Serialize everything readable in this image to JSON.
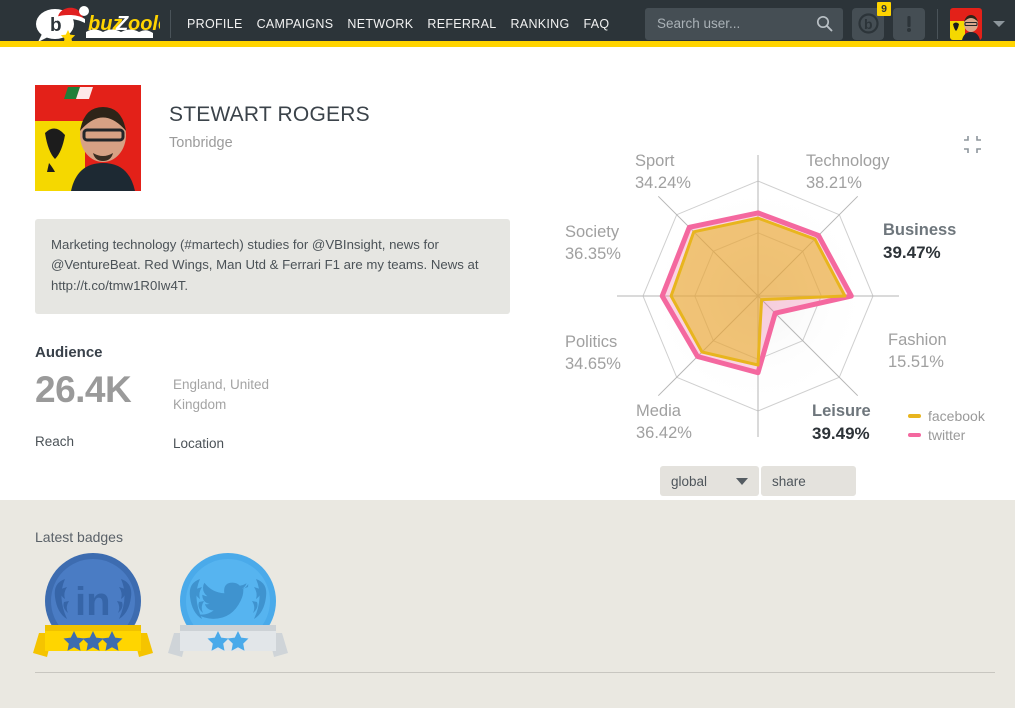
{
  "brand": {
    "logo_text": "buzZoole",
    "accent_yellow": "#ffd400",
    "header_bg": "#2c3439"
  },
  "header": {
    "nav": [
      {
        "label": "PROFILE",
        "name": "nav-profile"
      },
      {
        "label": "CAMPAIGNS",
        "name": "nav-campaigns"
      },
      {
        "label": "NETWORK",
        "name": "nav-network"
      },
      {
        "label": "REFERRAL",
        "name": "nav-referral"
      },
      {
        "label": "RANKING",
        "name": "nav-ranking"
      },
      {
        "label": "FAQ",
        "name": "nav-faq"
      }
    ],
    "search": {
      "placeholder": "Search user...",
      "value": "",
      "icon": "search-icon"
    },
    "buzz_button": {
      "icon": "buzzoole-b-icon",
      "badge_count": "9"
    },
    "alert_button": {
      "icon": "exclamation-icon"
    },
    "account": {
      "icon": "avatar",
      "caret": "chevron-down-icon"
    }
  },
  "profile": {
    "name": "STEWART ROGERS",
    "city": "Tonbridge",
    "bio": "Marketing technology (#martech) studies for @VBInsight, news for @VentureBeat. Red Wings, Man Utd & Ferrari F1 are my teams. News at http://t.co/tmw1R0Iw4T.",
    "audience_heading": "Audience",
    "reach_value": "26.4K",
    "reach_label": "Reach",
    "location_value": "England, United Kingdom",
    "location_label": "Location"
  },
  "radar": {
    "collapse_icon": "collapse-icon",
    "controls": {
      "scope_selected": "global",
      "scope_caret": "chevron-down-icon",
      "share_label": "share"
    },
    "legend": [
      {
        "label": "facebook",
        "color": "#e8b51e"
      },
      {
        "label": "twitter",
        "color": "#f4689f"
      }
    ]
  },
  "chart_data": {
    "type": "radar",
    "title": "",
    "categories": [
      "Technology",
      "Business",
      "Fashion",
      "Leisure",
      "Media",
      "Politics",
      "Society",
      "Sport"
    ],
    "labels": [
      {
        "name": "Technology",
        "pct": "38.21%",
        "value": 38.21,
        "highlight": false
      },
      {
        "name": "Business",
        "pct": "39.47%",
        "value": 39.47,
        "highlight": true
      },
      {
        "name": "Fashion",
        "pct": "15.51%",
        "value": 15.51,
        "highlight": false
      },
      {
        "name": "Leisure",
        "pct": "39.49%",
        "value": 39.49,
        "highlight": true
      },
      {
        "name": "Media",
        "pct": "36.42%",
        "value": 36.42,
        "highlight": false
      },
      {
        "name": "Politics",
        "pct": "34.65%",
        "value": 34.65,
        "highlight": false
      },
      {
        "name": "Society",
        "pct": "36.35%",
        "value": 36.35,
        "highlight": false
      },
      {
        "name": "Sport",
        "pct": "34.24%",
        "value": 34.24,
        "highlight": false
      }
    ],
    "series": [
      {
        "name": "facebook",
        "color": "#e8b51e",
        "values": [
          31.5,
          34.0,
          2.0,
          27.0,
          31.0,
          34.0,
          35.5,
          30.5
        ]
      },
      {
        "name": "twitter",
        "color": "#f4689f",
        "values": [
          33.5,
          36.5,
          9.5,
          30.0,
          33.5,
          37.5,
          38.0,
          32.5
        ]
      }
    ],
    "rings": [
      0.55,
      1.0
    ],
    "max": 45,
    "grid": true,
    "legend_position": "right"
  },
  "badges": {
    "title": "Latest badges",
    "items": [
      {
        "network": "linkedin",
        "icon": "linkedin-icon",
        "ribbon": "gold",
        "stars": 3
      },
      {
        "network": "twitter",
        "icon": "twitter-bird-icon",
        "ribbon": "silver",
        "stars": 2
      }
    ]
  }
}
